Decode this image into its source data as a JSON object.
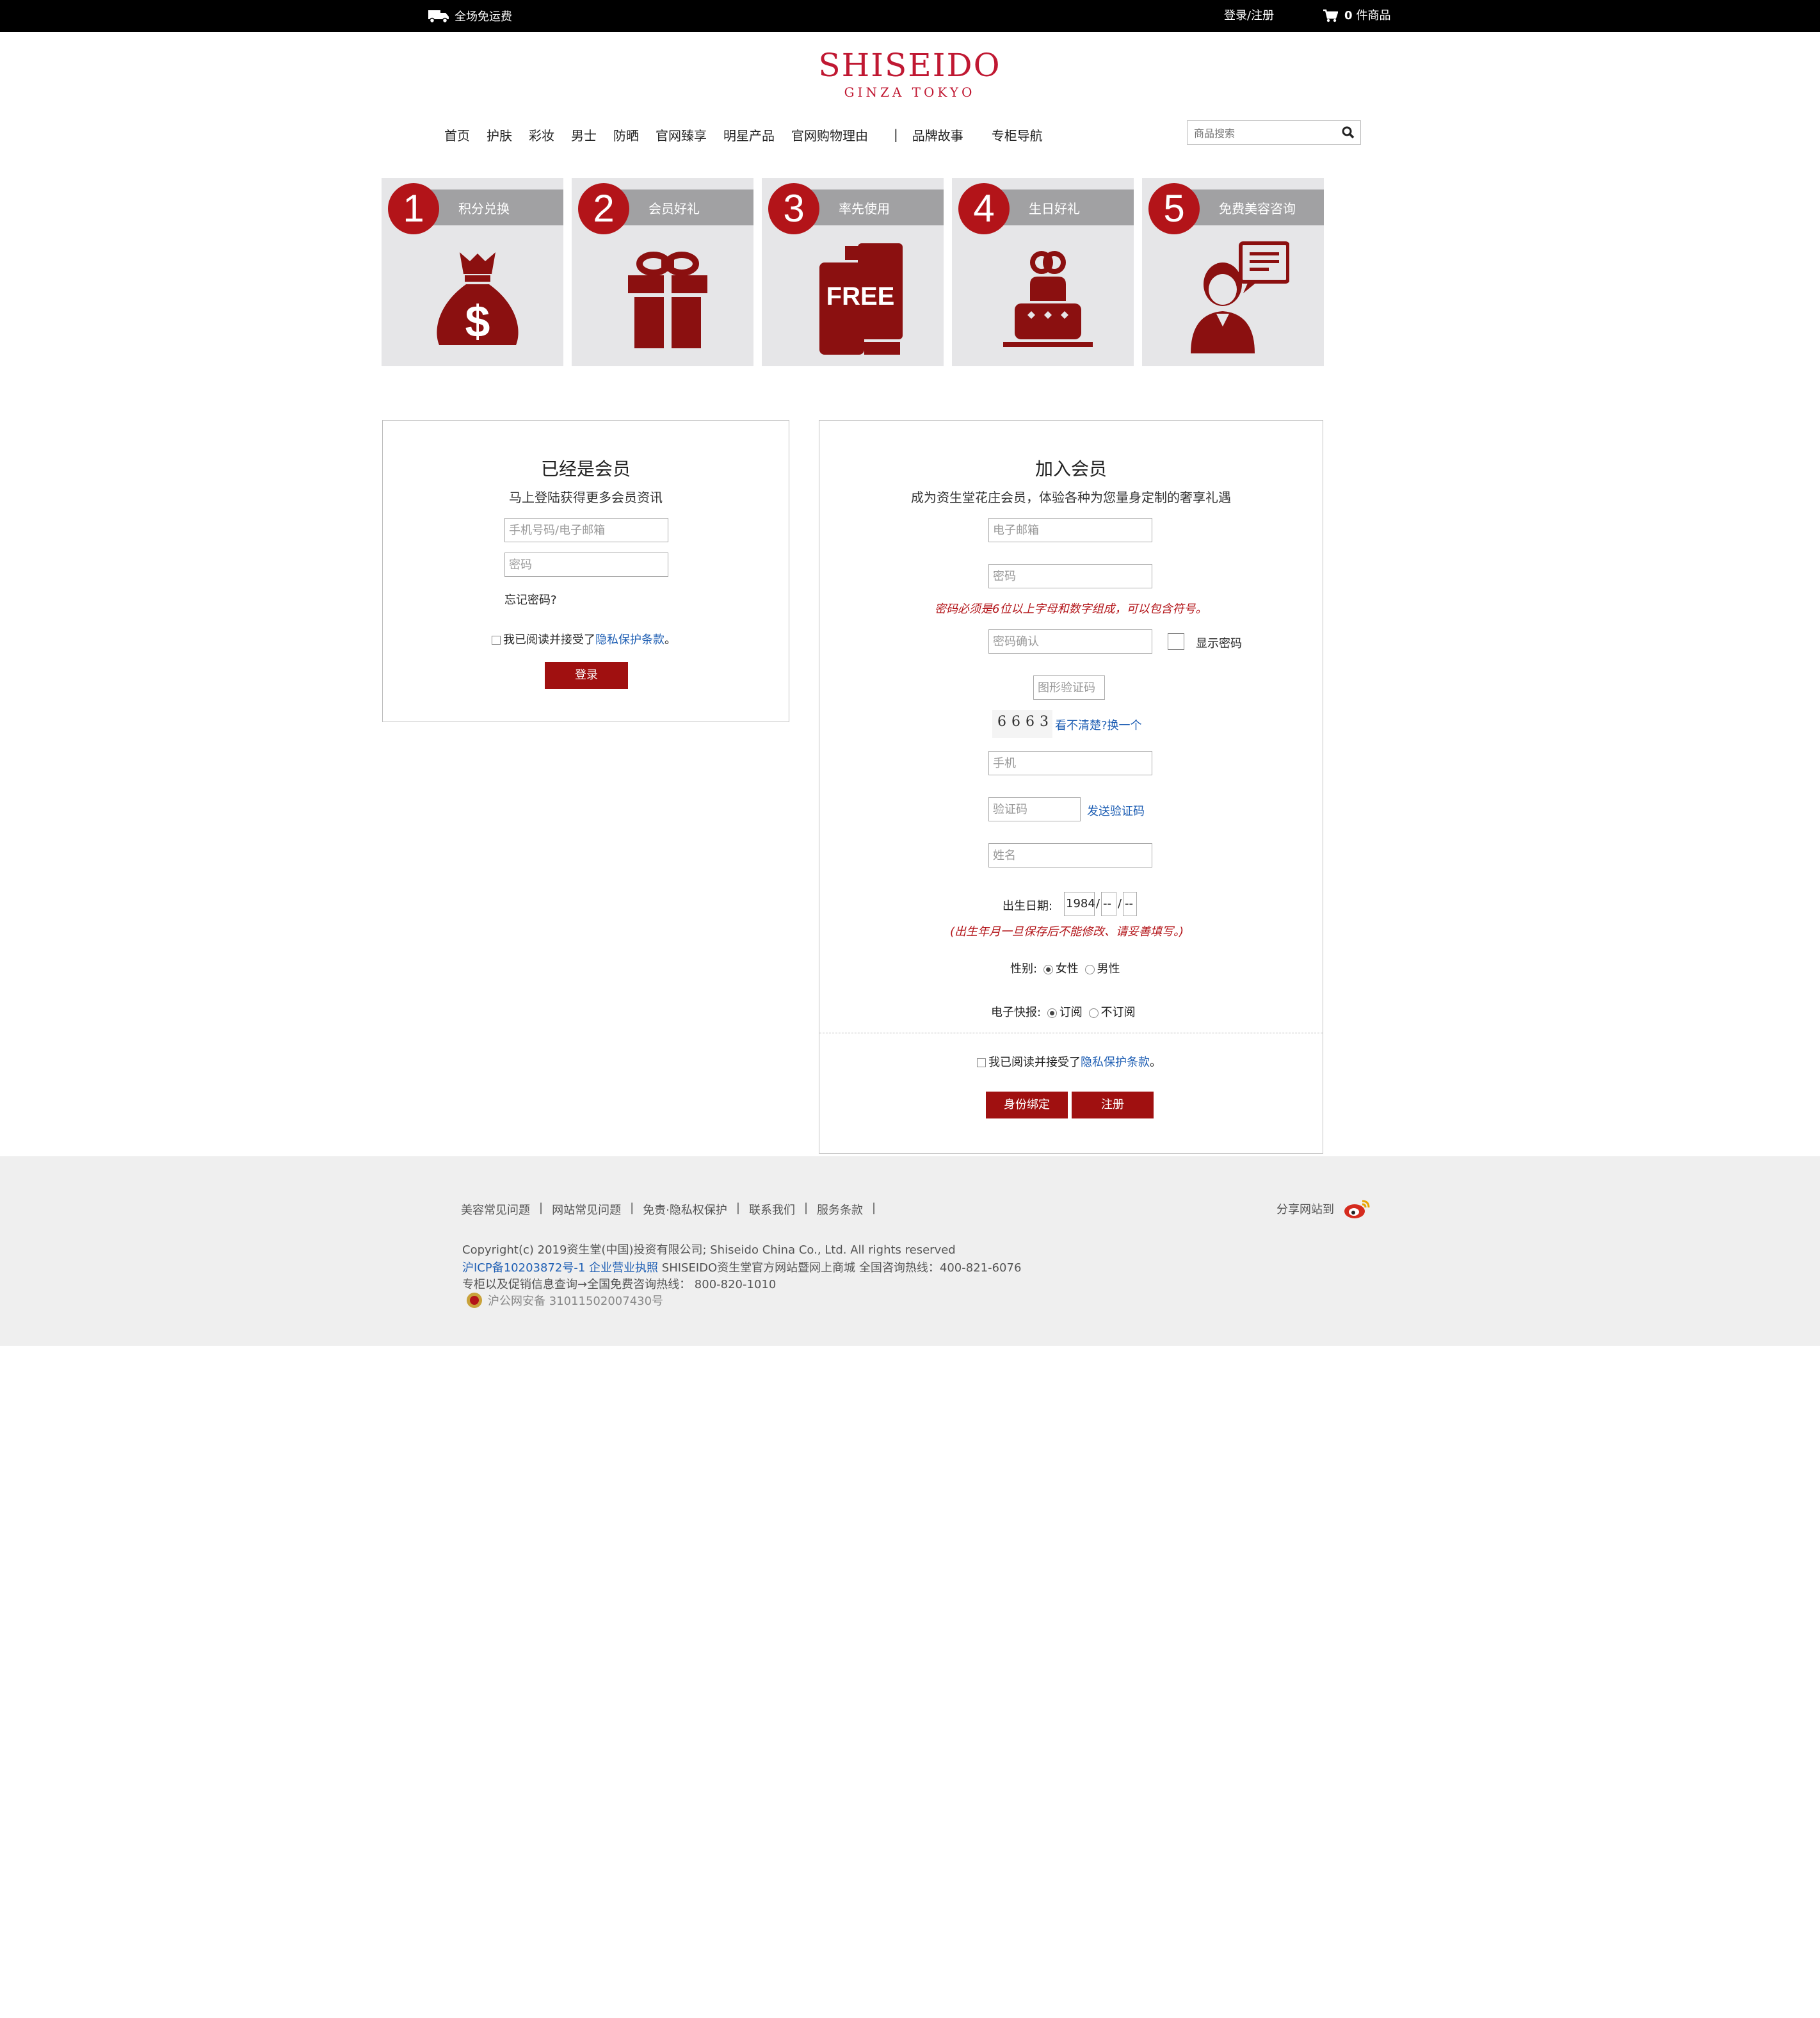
{
  "topbar": {
    "free_shipping": "全场免运费",
    "login_register": "登录/注册",
    "cart_count": "0",
    "cart_label": "件商品"
  },
  "logo": {
    "brand": "SHISEIDO",
    "sub": "GINZA TOKYO"
  },
  "nav": {
    "items": [
      "首页",
      "护肤",
      "彩妆",
      "男士",
      "防晒",
      "官网臻享",
      "明星产品",
      "官网购物理由"
    ],
    "separator": "|",
    "extra": [
      "品牌故事",
      "专柜导航"
    ],
    "search_placeholder": "商品搜索"
  },
  "benefits": [
    {
      "num": "1",
      "label": "积分兑换",
      "icon": "money-bag-icon"
    },
    {
      "num": "2",
      "label": "会员好礼",
      "icon": "gift-icon"
    },
    {
      "num": "3",
      "label": "率先使用",
      "icon": "free-sample-icon"
    },
    {
      "num": "4",
      "label": "生日好礼",
      "icon": "cake-icon"
    },
    {
      "num": "5",
      "label": "免费美容咨询",
      "icon": "consultant-icon"
    }
  ],
  "free_sample_text": "FREE",
  "login": {
    "title": "已经是会员",
    "subtitle": "马上登陆获得更多会员资讯",
    "account_placeholder": "手机号码/电子邮箱",
    "password_placeholder": "密码",
    "forgot": "忘记密码?",
    "agree_prefix": "我已阅读并接受了",
    "privacy_link": "隐私保护条款",
    "agree_suffix": "。",
    "button": "登录"
  },
  "register": {
    "title": "加入会员",
    "subtitle": "成为资生堂花庄会员，体验各种为您量身定制的奢享礼遇",
    "email_placeholder": "电子邮箱",
    "password_placeholder": "密码",
    "password_note": "密码必须是6位以上字母和数字组成，可以包含符号。",
    "confirm_placeholder": "密码确认",
    "show_password": "显示密码",
    "captcha_placeholder": "图形验证码",
    "captcha_text": "6663",
    "captcha_refresh": "看不清楚?换一个",
    "phone_placeholder": "手机",
    "sms_placeholder": "验证码",
    "send_code": "发送验证码",
    "name_placeholder": "姓名",
    "birth_label": "出生日期:",
    "birth_year": "1984",
    "birth_month": "--",
    "birth_day": "--",
    "birth_slash": "/",
    "birth_note": "(出生年月一旦保存后不能修改、请妥善填写。)",
    "gender_label": "性别:",
    "gender_female": "女性",
    "gender_male": "男性",
    "newsletter_label": "电子快报:",
    "newsletter_yes": "订阅",
    "newsletter_no": "不订阅",
    "agree_prefix": "我已阅读并接受了",
    "privacy_link": "隐私保护条款",
    "agree_suffix": "。",
    "bind_button": "身份绑定",
    "register_button": "注册"
  },
  "footer": {
    "links": [
      "美容常见问题",
      "网站常见问题",
      "免责·隐私权保护",
      "联系我们",
      "服务条款"
    ],
    "separator": "|",
    "share": "分享网站到",
    "copyright": "Copyright(c) 2019资生堂(中国)投资有限公司; Shiseido China Co., Ltd. All rights reserved",
    "icp_link": "沪ICP备10203872号-1",
    "license_link": "企业营业执照",
    "icp_rest": "SHISEIDO资生堂官方网站暨网上商城 全国咨询热线：400-821-6076",
    "counter_line": "专柜以及促销信息查询→全国免费咨询热线：  800-820-1010",
    "police": "沪公网安备 31011502007430号"
  },
  "colors": {
    "brand_red": "#c01832",
    "button_red": "#a01010",
    "link_blue": "#1f5fb4",
    "footer_bg": "#efefef"
  }
}
